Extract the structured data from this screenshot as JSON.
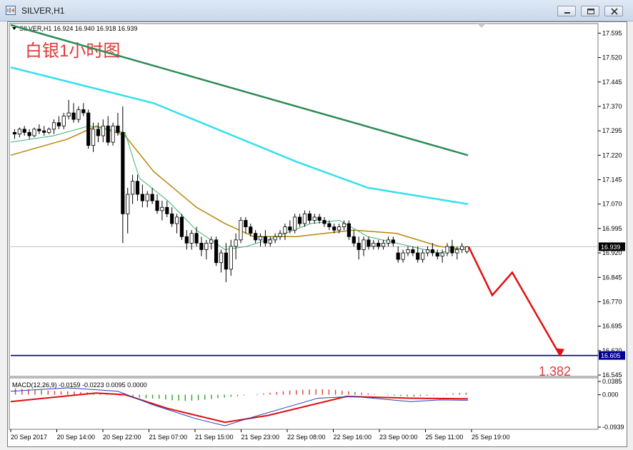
{
  "window": {
    "title": "SILVER,H1",
    "buttons": {
      "minimize": "minimize-icon",
      "restore": "restore-icon",
      "close": "close-icon"
    }
  },
  "chart_data": {
    "type": "candlestick",
    "symbol_header": "SILVER,H1  16.924 16.940 16.918 16.939",
    "annotation_cn": "白银1小时图",
    "target_label": "1.382",
    "price_axis": {
      "ticks": [
        "17.595",
        "17.520",
        "17.445",
        "17.370",
        "17.295",
        "17.220",
        "17.145",
        "17.070",
        "16.995",
        "16.920",
        "16.845",
        "16.770",
        "16.695",
        "16.620",
        "16.545"
      ],
      "range": [
        16.545,
        17.62
      ],
      "current_price": "16.939",
      "line_level": "16.605"
    },
    "time_axis": [
      "20 Sep 2017",
      "20 Sep 14:00",
      "20 Sep 22:00",
      "21 Sep 07:00",
      "21 Sep 15:00",
      "21 Sep 23:00",
      "22 Sep 08:00",
      "22 Sep 16:00",
      "23 Sep 00:00",
      "25 Sep 11:00",
      "25 Sep 19:00"
    ],
    "candles": [
      [
        17.29,
        17.3,
        17.27,
        17.285
      ],
      [
        17.285,
        17.305,
        17.275,
        17.3
      ],
      [
        17.3,
        17.31,
        17.28,
        17.29
      ],
      [
        17.29,
        17.3,
        17.27,
        17.28
      ],
      [
        17.28,
        17.305,
        17.275,
        17.3
      ],
      [
        17.3,
        17.315,
        17.285,
        17.295
      ],
      [
        17.295,
        17.31,
        17.28,
        17.29
      ],
      [
        17.29,
        17.305,
        17.285,
        17.3
      ],
      [
        17.3,
        17.33,
        17.285,
        17.32
      ],
      [
        17.32,
        17.34,
        17.3,
        17.31
      ],
      [
        17.31,
        17.35,
        17.3,
        17.34
      ],
      [
        17.34,
        17.39,
        17.33,
        17.35
      ],
      [
        17.35,
        17.38,
        17.32,
        17.33
      ],
      [
        17.33,
        17.37,
        17.32,
        17.36
      ],
      [
        17.36,
        17.38,
        17.34,
        17.35
      ],
      [
        17.35,
        17.36,
        17.24,
        17.25
      ],
      [
        17.25,
        17.32,
        17.23,
        17.3
      ],
      [
        17.3,
        17.32,
        17.26,
        17.28
      ],
      [
        17.28,
        17.33,
        17.26,
        17.31
      ],
      [
        17.31,
        17.34,
        17.25,
        17.26
      ],
      [
        17.26,
        17.32,
        17.25,
        17.31
      ],
      [
        17.31,
        17.35,
        17.28,
        17.29
      ],
      [
        17.29,
        17.37,
        16.95,
        17.04
      ],
      [
        17.04,
        17.12,
        16.98,
        17.1
      ],
      [
        17.1,
        17.16,
        17.07,
        17.14
      ],
      [
        17.14,
        17.16,
        17.08,
        17.1
      ],
      [
        17.1,
        17.13,
        17.06,
        17.08
      ],
      [
        17.08,
        17.11,
        17.06,
        17.1
      ],
      [
        17.1,
        17.12,
        17.07,
        17.08
      ],
      [
        17.08,
        17.1,
        17.04,
        17.05
      ],
      [
        17.05,
        17.08,
        17.02,
        17.06
      ],
      [
        17.06,
        17.08,
        17.03,
        17.04
      ],
      [
        17.04,
        17.06,
        17.0,
        17.01
      ],
      [
        17.01,
        17.04,
        16.98,
        17.03
      ],
      [
        17.03,
        17.04,
        16.96,
        16.97
      ],
      [
        16.97,
        16.99,
        16.93,
        16.95
      ],
      [
        16.95,
        16.99,
        16.93,
        16.98
      ],
      [
        16.98,
        17.0,
        16.94,
        16.95
      ],
      [
        16.95,
        16.97,
        16.91,
        16.93
      ],
      [
        16.93,
        16.96,
        16.9,
        16.95
      ],
      [
        16.95,
        16.97,
        16.93,
        16.96
      ],
      [
        16.96,
        16.97,
        16.88,
        16.89
      ],
      [
        16.89,
        16.93,
        16.86,
        16.92
      ],
      [
        16.92,
        16.95,
        16.83,
        16.87
      ],
      [
        16.87,
        16.96,
        16.85,
        16.94
      ],
      [
        16.94,
        16.98,
        16.9,
        16.96
      ],
      [
        16.96,
        17.03,
        16.95,
        17.02
      ],
      [
        17.02,
        17.03,
        16.98,
        17.0
      ],
      [
        17.0,
        17.01,
        16.97,
        16.98
      ],
      [
        16.98,
        16.99,
        16.95,
        16.96
      ],
      [
        16.96,
        16.98,
        16.94,
        16.97
      ],
      [
        16.97,
        16.99,
        16.94,
        16.95
      ],
      [
        16.95,
        16.97,
        16.94,
        16.96
      ],
      [
        16.96,
        16.98,
        16.95,
        16.97
      ],
      [
        16.97,
        16.99,
        16.96,
        16.98
      ],
      [
        16.98,
        17.01,
        16.96,
        17.0
      ],
      [
        17.0,
        17.02,
        16.98,
        16.99
      ],
      [
        16.99,
        17.04,
        16.98,
        17.03
      ],
      [
        17.03,
        17.04,
        17.0,
        17.01
      ],
      [
        17.01,
        17.05,
        17.0,
        17.04
      ],
      [
        17.04,
        17.05,
        17.01,
        17.02
      ],
      [
        17.02,
        17.04,
        17.01,
        17.03
      ],
      [
        17.03,
        17.04,
        17.01,
        17.02
      ],
      [
        17.02,
        17.03,
        17.0,
        17.01
      ],
      [
        17.01,
        17.02,
        16.99,
        17.0
      ],
      [
        17.0,
        17.01,
        16.98,
        16.99
      ],
      [
        16.99,
        17.01,
        16.98,
        17.0
      ],
      [
        17.0,
        17.02,
        16.99,
        17.01
      ],
      [
        17.01,
        17.02,
        16.96,
        16.97
      ],
      [
        16.97,
        16.99,
        16.94,
        16.95
      ],
      [
        16.95,
        16.97,
        16.9,
        16.93
      ],
      [
        16.93,
        16.97,
        16.91,
        16.96
      ],
      [
        16.96,
        16.97,
        16.93,
        16.94
      ],
      [
        16.94,
        16.96,
        16.93,
        16.95
      ],
      [
        16.95,
        16.96,
        16.93,
        16.94
      ],
      [
        16.94,
        16.96,
        16.93,
        16.95
      ],
      [
        16.95,
        16.97,
        16.94,
        16.96
      ],
      [
        16.96,
        16.97,
        16.94,
        16.95
      ],
      [
        16.92,
        16.94,
        16.89,
        16.9
      ],
      [
        16.9,
        16.93,
        16.89,
        16.92
      ],
      [
        16.92,
        16.94,
        16.91,
        16.93
      ],
      [
        16.93,
        16.94,
        16.91,
        16.92
      ],
      [
        16.92,
        16.94,
        16.89,
        16.9
      ],
      [
        16.9,
        16.93,
        16.89,
        16.92
      ],
      [
        16.92,
        16.94,
        16.91,
        16.93
      ],
      [
        16.93,
        16.95,
        16.91,
        16.92
      ],
      [
        16.92,
        16.93,
        16.9,
        16.91
      ],
      [
        16.91,
        16.93,
        16.89,
        16.92
      ],
      [
        16.92,
        16.95,
        16.91,
        16.94
      ],
      [
        16.94,
        16.96,
        16.91,
        16.92
      ],
      [
        16.92,
        16.94,
        16.9,
        16.93
      ],
      [
        16.93,
        16.95,
        16.92,
        16.94
      ],
      [
        16.924,
        16.94,
        16.918,
        16.939
      ]
    ],
    "ma_slow_green": [
      [
        0,
        17.62
      ],
      [
        640,
        17.22
      ]
    ],
    "ma_cyan": [
      [
        0,
        17.49
      ],
      [
        200,
        17.38
      ],
      [
        400,
        17.2
      ],
      [
        500,
        17.12
      ],
      [
        640,
        17.07
      ]
    ],
    "ma_gold": [
      [
        0,
        17.22
      ],
      [
        80,
        17.27
      ],
      [
        120,
        17.31
      ],
      [
        160,
        17.28
      ],
      [
        200,
        17.17
      ],
      [
        260,
        17.06
      ],
      [
        300,
        17.01
      ],
      [
        340,
        16.97
      ],
      [
        400,
        16.97
      ],
      [
        480,
        16.99
      ],
      [
        540,
        16.98
      ],
      [
        600,
        16.94
      ],
      [
        640,
        16.93
      ]
    ],
    "ma_fast_green": [
      [
        0,
        17.26
      ],
      [
        60,
        17.28
      ],
      [
        110,
        17.31
      ],
      [
        160,
        17.29
      ],
      [
        180,
        17.15
      ],
      [
        220,
        17.08
      ],
      [
        260,
        16.99
      ],
      [
        300,
        16.93
      ],
      [
        330,
        16.94
      ],
      [
        360,
        16.96
      ],
      [
        420,
        17.01
      ],
      [
        460,
        17.02
      ],
      [
        500,
        16.97
      ],
      [
        560,
        16.94
      ],
      [
        600,
        16.92
      ],
      [
        640,
        16.94
      ]
    ],
    "projection_path": [
      [
        645,
        16.939
      ],
      [
        678,
        16.79
      ],
      [
        706,
        16.86
      ],
      [
        773,
        16.605
      ]
    ],
    "macd": {
      "label": "MACD(12,26,9) -0.0159 -0.0223 0.0095 0.0000",
      "ticks": [
        "0.0385",
        "0.000",
        "-0.0939"
      ],
      "range": [
        -0.0939,
        0.0385
      ],
      "histogram": [
        0.018,
        0.017,
        0.016,
        0.014,
        0.013,
        0.012,
        0.011,
        0.01,
        0.01,
        0.009,
        0.008,
        0.007,
        0.006,
        0.004,
        0.002,
        0.0,
        -0.002,
        -0.004,
        -0.006,
        -0.008,
        -0.01,
        -0.011,
        -0.012,
        -0.014,
        -0.016,
        -0.017,
        -0.018,
        -0.017,
        -0.016,
        -0.014,
        -0.012,
        -0.01,
        -0.008,
        -0.006,
        -0.004,
        -0.002,
        0.0,
        0.002,
        0.004,
        0.006,
        0.008,
        0.01,
        0.012,
        0.013,
        0.014,
        0.015,
        0.016,
        0.016,
        0.015,
        0.014,
        0.012,
        0.01,
        0.008,
        0.006,
        0.004,
        0.002,
        0.0,
        -0.002,
        -0.003,
        -0.004,
        -0.005,
        -0.005,
        -0.004,
        -0.003,
        -0.002,
        0.0,
        0.002,
        0.004,
        0.005,
        0.006
      ],
      "signal": [
        [
          0,
          -0.02
        ],
        [
          120,
          0.005
        ],
        [
          160,
          0.0
        ],
        [
          220,
          -0.04
        ],
        [
          300,
          -0.08
        ],
        [
          360,
          -0.06
        ],
        [
          420,
          -0.03
        ],
        [
          470,
          -0.005
        ],
        [
          560,
          -0.01
        ],
        [
          640,
          -0.012
        ]
      ],
      "line": [
        [
          0,
          0.01
        ],
        [
          80,
          0.02
        ],
        [
          150,
          0.01
        ],
        [
          200,
          -0.03
        ],
        [
          260,
          -0.07
        ],
        [
          300,
          -0.09
        ],
        [
          330,
          -0.07
        ],
        [
          380,
          -0.04
        ],
        [
          430,
          -0.01
        ],
        [
          480,
          -0.005
        ],
        [
          560,
          -0.02
        ],
        [
          600,
          -0.015
        ],
        [
          640,
          -0.016
        ]
      ]
    }
  }
}
